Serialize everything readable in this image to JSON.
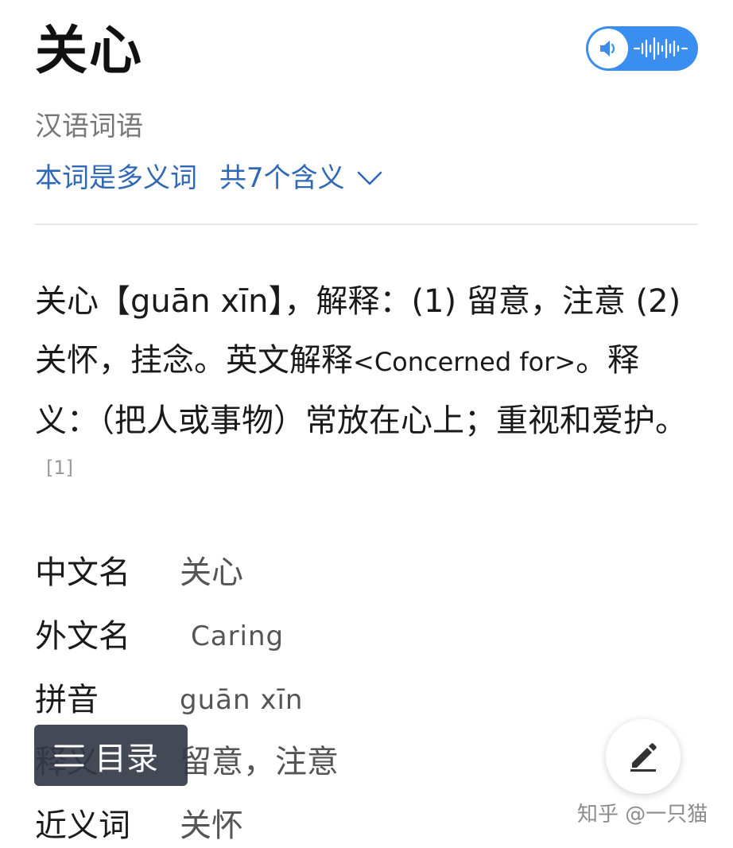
{
  "header": {
    "title": "关心",
    "audio_button": {
      "icon": "speaker-icon",
      "wave_icon": "sound-wave-icon",
      "color": "#3a8ef0"
    }
  },
  "subtitle": "汉语词语",
  "polysemy": {
    "label": "本词是多义词",
    "count_label": "共7个含义",
    "icon": "chevron-down-icon",
    "color": "#3068b8"
  },
  "description": {
    "part1": "关心【guān xīn】，解释：(1) 留意，注意 (2) 关怀，挂念。英文解释",
    "english": "<Concerned for>",
    "part2": "。释义：（把人或事物）常放在心上；重视和爱护。",
    "ref": "[1]"
  },
  "info": [
    {
      "key": "中文名",
      "value": "关心"
    },
    {
      "key": "外文名",
      "value": "Caring"
    },
    {
      "key": "拼音",
      "value": "guān xīn"
    },
    {
      "key": "释义",
      "value": "留意，注意"
    },
    {
      "key": "近义词",
      "value": "关怀"
    }
  ],
  "toc_button": {
    "icon": "menu-icon",
    "label": "目录"
  },
  "edit_button": {
    "icon": "pencil-icon"
  },
  "watermark": "知乎 @一只猫"
}
